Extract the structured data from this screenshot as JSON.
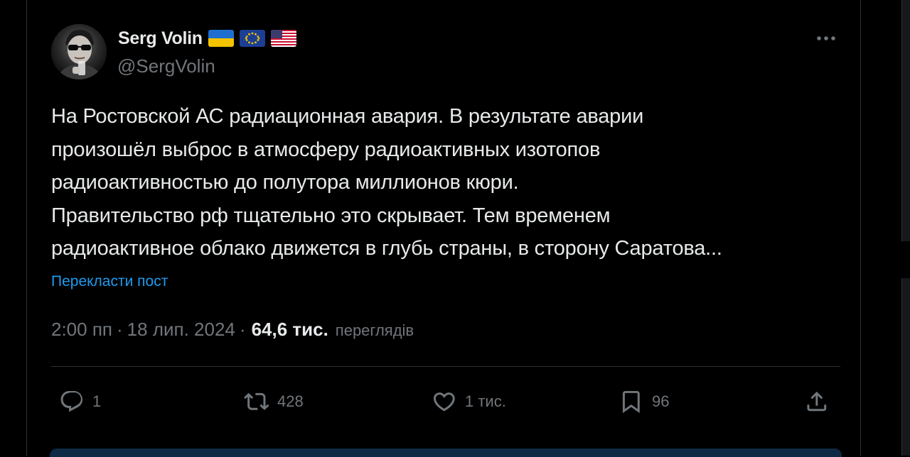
{
  "tweet": {
    "author_name": "Serg Volin",
    "handle": "@SergVolin",
    "flags": [
      "ukraine-flag",
      "eu-flag",
      "usa-flag"
    ],
    "text_lines": [
      "На Ростовской АС радиационная авария. В результате аварии",
      "произошёл выброс в атмосферу радиоактивных изотопов",
      "радиоактивностью до полутора миллионов кюри.",
      "Правительство рф тщательно это скрывает. Тем временем",
      "радиоактивное облако движется в глубь страны, в сторону Саратова..."
    ],
    "translate_label": "Перекласти пост",
    "time": "2:00 пп",
    "date": "18 лип. 2024",
    "separator": "·",
    "views_count": "64,6 тис.",
    "views_label": "переглядів",
    "actions": {
      "replies": "1",
      "reposts": "428",
      "likes": "1 тис.",
      "bookmarks": "96"
    }
  },
  "colors": {
    "background": "#000000",
    "text_primary": "#e7e9ea",
    "text_secondary": "#71767b",
    "accent": "#1d9bf0",
    "border": "#2f3336"
  }
}
